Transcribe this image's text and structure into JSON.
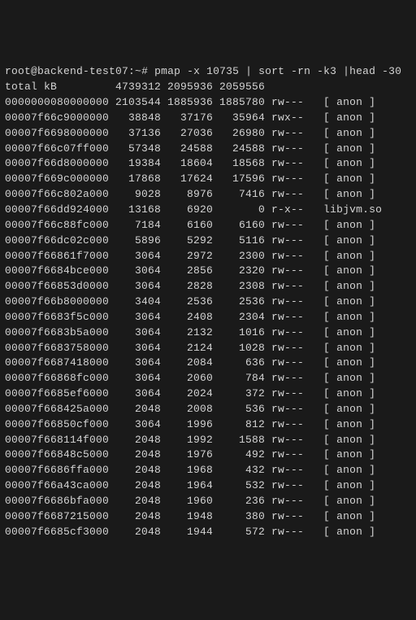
{
  "prompt": {
    "user_host": "root@backend-test07",
    "path": "~",
    "symbol": "#",
    "command": "pmap -x 10735 | sort -rn -k3 |head -30"
  },
  "total_label": "total kB",
  "totals": {
    "c1": "4739312",
    "c2": "2095936",
    "c3": "2059556"
  },
  "rows": [
    {
      "addr": "0000000080000000",
      "c1": "2103544",
      "c2": "1885936",
      "c3": "1885780",
      "perm": "rw---",
      "map": "[ anon ]"
    },
    {
      "addr": "00007f66c9000000",
      "c1": "38848",
      "c2": "37176",
      "c3": "35964",
      "perm": "rwx--",
      "map": "[ anon ]"
    },
    {
      "addr": "00007f6698000000",
      "c1": "37136",
      "c2": "27036",
      "c3": "26980",
      "perm": "rw---",
      "map": "[ anon ]"
    },
    {
      "addr": "00007f66c07ff000",
      "c1": "57348",
      "c2": "24588",
      "c3": "24588",
      "perm": "rw---",
      "map": "[ anon ]"
    },
    {
      "addr": "00007f66d8000000",
      "c1": "19384",
      "c2": "18604",
      "c3": "18568",
      "perm": "rw---",
      "map": "[ anon ]"
    },
    {
      "addr": "00007f669c000000",
      "c1": "17868",
      "c2": "17624",
      "c3": "17596",
      "perm": "rw---",
      "map": "[ anon ]"
    },
    {
      "addr": "00007f66c802a000",
      "c1": "9028",
      "c2": "8976",
      "c3": "7416",
      "perm": "rw---",
      "map": "[ anon ]"
    },
    {
      "addr": "00007f66dd924000",
      "c1": "13168",
      "c2": "6920",
      "c3": "0",
      "perm": "r-x--",
      "map": "libjvm.so"
    },
    {
      "addr": "00007f66c88fc000",
      "c1": "7184",
      "c2": "6160",
      "c3": "6160",
      "perm": "rw---",
      "map": "[ anon ]"
    },
    {
      "addr": "00007f66dc02c000",
      "c1": "5896",
      "c2": "5292",
      "c3": "5116",
      "perm": "rw---",
      "map": "[ anon ]"
    },
    {
      "addr": "00007f66861f7000",
      "c1": "3064",
      "c2": "2972",
      "c3": "2300",
      "perm": "rw---",
      "map": "[ anon ]"
    },
    {
      "addr": "00007f6684bce000",
      "c1": "3064",
      "c2": "2856",
      "c3": "2320",
      "perm": "rw---",
      "map": "[ anon ]"
    },
    {
      "addr": "00007f66853d0000",
      "c1": "3064",
      "c2": "2828",
      "c3": "2308",
      "perm": "rw---",
      "map": "[ anon ]"
    },
    {
      "addr": "00007f66b8000000",
      "c1": "3404",
      "c2": "2536",
      "c3": "2536",
      "perm": "rw---",
      "map": "[ anon ]"
    },
    {
      "addr": "00007f6683f5c000",
      "c1": "3064",
      "c2": "2408",
      "c3": "2304",
      "perm": "rw---",
      "map": "[ anon ]"
    },
    {
      "addr": "00007f6683b5a000",
      "c1": "3064",
      "c2": "2132",
      "c3": "1016",
      "perm": "rw---",
      "map": "[ anon ]"
    },
    {
      "addr": "00007f6683758000",
      "c1": "3064",
      "c2": "2124",
      "c3": "1028",
      "perm": "rw---",
      "map": "[ anon ]"
    },
    {
      "addr": "00007f6687418000",
      "c1": "3064",
      "c2": "2084",
      "c3": "636",
      "perm": "rw---",
      "map": "[ anon ]"
    },
    {
      "addr": "00007f66868fc000",
      "c1": "3064",
      "c2": "2060",
      "c3": "784",
      "perm": "rw---",
      "map": "[ anon ]"
    },
    {
      "addr": "00007f6685ef6000",
      "c1": "3064",
      "c2": "2024",
      "c3": "372",
      "perm": "rw---",
      "map": "[ anon ]"
    },
    {
      "addr": "00007f668425a000",
      "c1": "2048",
      "c2": "2008",
      "c3": "536",
      "perm": "rw---",
      "map": "[ anon ]"
    },
    {
      "addr": "00007f66850cf000",
      "c1": "3064",
      "c2": "1996",
      "c3": "812",
      "perm": "rw---",
      "map": "[ anon ]"
    },
    {
      "addr": "00007f668114f000",
      "c1": "2048",
      "c2": "1992",
      "c3": "1588",
      "perm": "rw---",
      "map": "[ anon ]"
    },
    {
      "addr": "00007f66848c5000",
      "c1": "2048",
      "c2": "1976",
      "c3": "492",
      "perm": "rw---",
      "map": "[ anon ]"
    },
    {
      "addr": "00007f6686ffa000",
      "c1": "2048",
      "c2": "1968",
      "c3": "432",
      "perm": "rw---",
      "map": "[ anon ]"
    },
    {
      "addr": "00007f66a43ca000",
      "c1": "2048",
      "c2": "1964",
      "c3": "532",
      "perm": "rw---",
      "map": "[ anon ]"
    },
    {
      "addr": "00007f6686bfa000",
      "c1": "2048",
      "c2": "1960",
      "c3": "236",
      "perm": "rw---",
      "map": "[ anon ]"
    },
    {
      "addr": "00007f6687215000",
      "c1": "2048",
      "c2": "1948",
      "c3": "380",
      "perm": "rw---",
      "map": "[ anon ]"
    },
    {
      "addr": "00007f6685cf3000",
      "c1": "2048",
      "c2": "1944",
      "c3": "572",
      "perm": "rw---",
      "map": "[ anon ]"
    }
  ]
}
